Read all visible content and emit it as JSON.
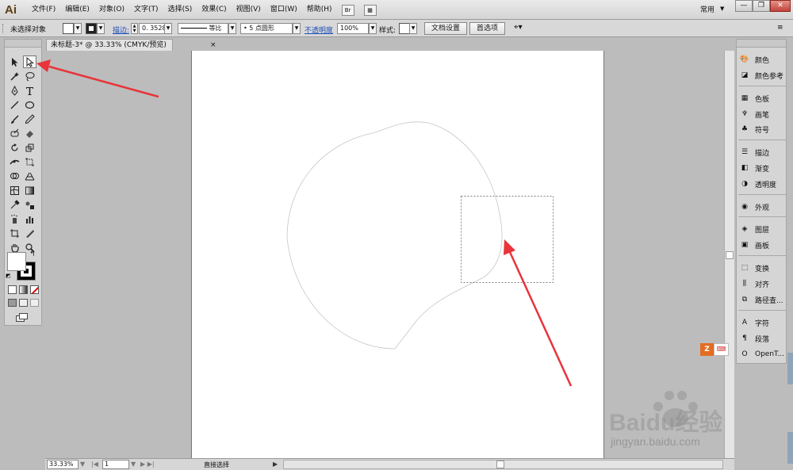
{
  "app": {
    "logo": "Ai",
    "workspace": "常用"
  },
  "menu": [
    "文件(F)",
    "编辑(E)",
    "对象(O)",
    "文字(T)",
    "选择(S)",
    "效果(C)",
    "视图(V)",
    "窗口(W)",
    "帮助(H)"
  ],
  "menu_buttons": {
    "bridge": "Br"
  },
  "window_controls": {
    "minimize": "—",
    "restore": "❐",
    "close": "✕"
  },
  "control": {
    "selection_label": "未选择对象",
    "stroke_link": "描边:",
    "stroke_value": "0. 3528",
    "profile": "等比",
    "brush": "5 点圆形",
    "opacity_link": "不透明度",
    "opacity_value": "100%",
    "style_label": "样式:",
    "doc_setup": "文档设置",
    "preferences": "首选项"
  },
  "document": {
    "tab_title": "未标题-3* @ 33.33% (CMYK/预览)",
    "close": "×"
  },
  "status": {
    "zoom": "33.33%",
    "page": "1",
    "tool_name": "直接选择"
  },
  "panels": [
    {
      "label": "颜色",
      "icon": "palette-icon"
    },
    {
      "label": "颜色参考",
      "icon": "color-guide-icon"
    },
    {
      "label": "色板",
      "icon": "swatches-icon"
    },
    {
      "label": "画笔",
      "icon": "brushes-icon"
    },
    {
      "label": "符号",
      "icon": "symbols-icon"
    },
    {
      "label": "描边",
      "icon": "stroke-icon"
    },
    {
      "label": "渐变",
      "icon": "gradient-icon"
    },
    {
      "label": "透明度",
      "icon": "transparency-icon"
    },
    {
      "label": "外观",
      "icon": "appearance-icon"
    },
    {
      "label": "图层",
      "icon": "layers-icon"
    },
    {
      "label": "画板",
      "icon": "artboards-icon"
    },
    {
      "label": "变换",
      "icon": "transform-icon"
    },
    {
      "label": "对齐",
      "icon": "align-icon"
    },
    {
      "label": "路径查...",
      "icon": "pathfinder-icon"
    },
    {
      "label": "字符",
      "icon": "character-icon"
    },
    {
      "label": "段落",
      "icon": "paragraph-icon"
    },
    {
      "label": "OpenT...",
      "icon": "opentype-icon"
    }
  ],
  "ime": {
    "logo": "Z",
    "keyboard": "⌨"
  },
  "watermark": {
    "brand": "Baidu经验",
    "url": "jingyan.baidu.com"
  },
  "colors": {
    "arrow": "#e8343a",
    "menubar": "#d8d8d8",
    "artboard": "#ffffff"
  }
}
